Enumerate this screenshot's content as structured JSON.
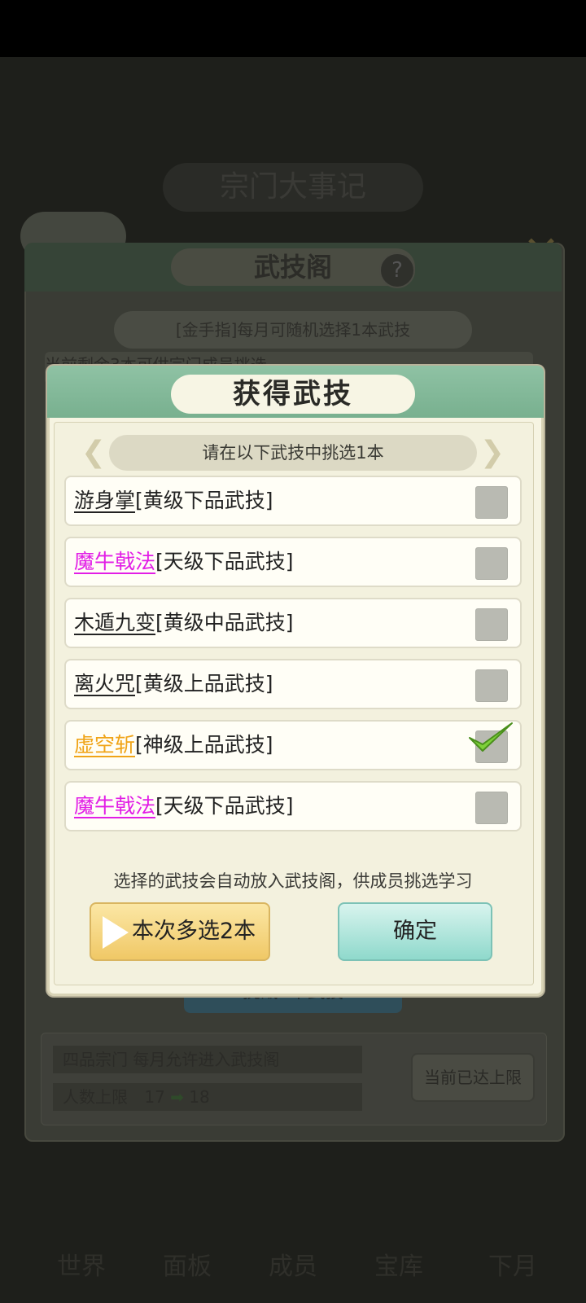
{
  "background": {
    "page_title": "宗门大事记",
    "panel_title": "武技阁",
    "help_icon": "?",
    "banner": "[金手指]每月可随机选择1本武技",
    "remaining_text": "当前剩余3本可供宗门成员挑选",
    "learn_button": "挑战1本武技",
    "stats": {
      "row1": "四品宗门   每月允许进入武技阁",
      "row2_label": "人数上限",
      "row2_from": "17",
      "row2_to": "18"
    },
    "limit_button": "当前已达上限",
    "nav": [
      "世界",
      "面板",
      "成员",
      "宝库",
      "下月"
    ]
  },
  "dialog": {
    "title": "获得武技",
    "subtitle": "请在以下武技中挑选1本",
    "items": [
      {
        "name": "游身掌",
        "grade": "[黄级下品武技]",
        "name_color": "#222222",
        "checked": false
      },
      {
        "name": "魔牛戟法",
        "grade": "[天级下品武技]",
        "name_color": "#e21ee6",
        "checked": false
      },
      {
        "name": "木遁九变",
        "grade": "[黄级中品武技]",
        "name_color": "#222222",
        "checked": false
      },
      {
        "name": "离火咒",
        "grade": "[黄级上品武技]",
        "name_color": "#222222",
        "checked": false
      },
      {
        "name": "虚空斩",
        "grade": "[神级上品武技]",
        "name_color": "#f0a418",
        "checked": true
      },
      {
        "name": "魔牛戟法",
        "grade": "[天级下品武技]",
        "name_color": "#e21ee6",
        "checked": false
      }
    ],
    "note": "选择的武技会自动放入武技阁，供成员挑选学习",
    "multi_button": "本次多选2本",
    "confirm_button": "确定"
  }
}
